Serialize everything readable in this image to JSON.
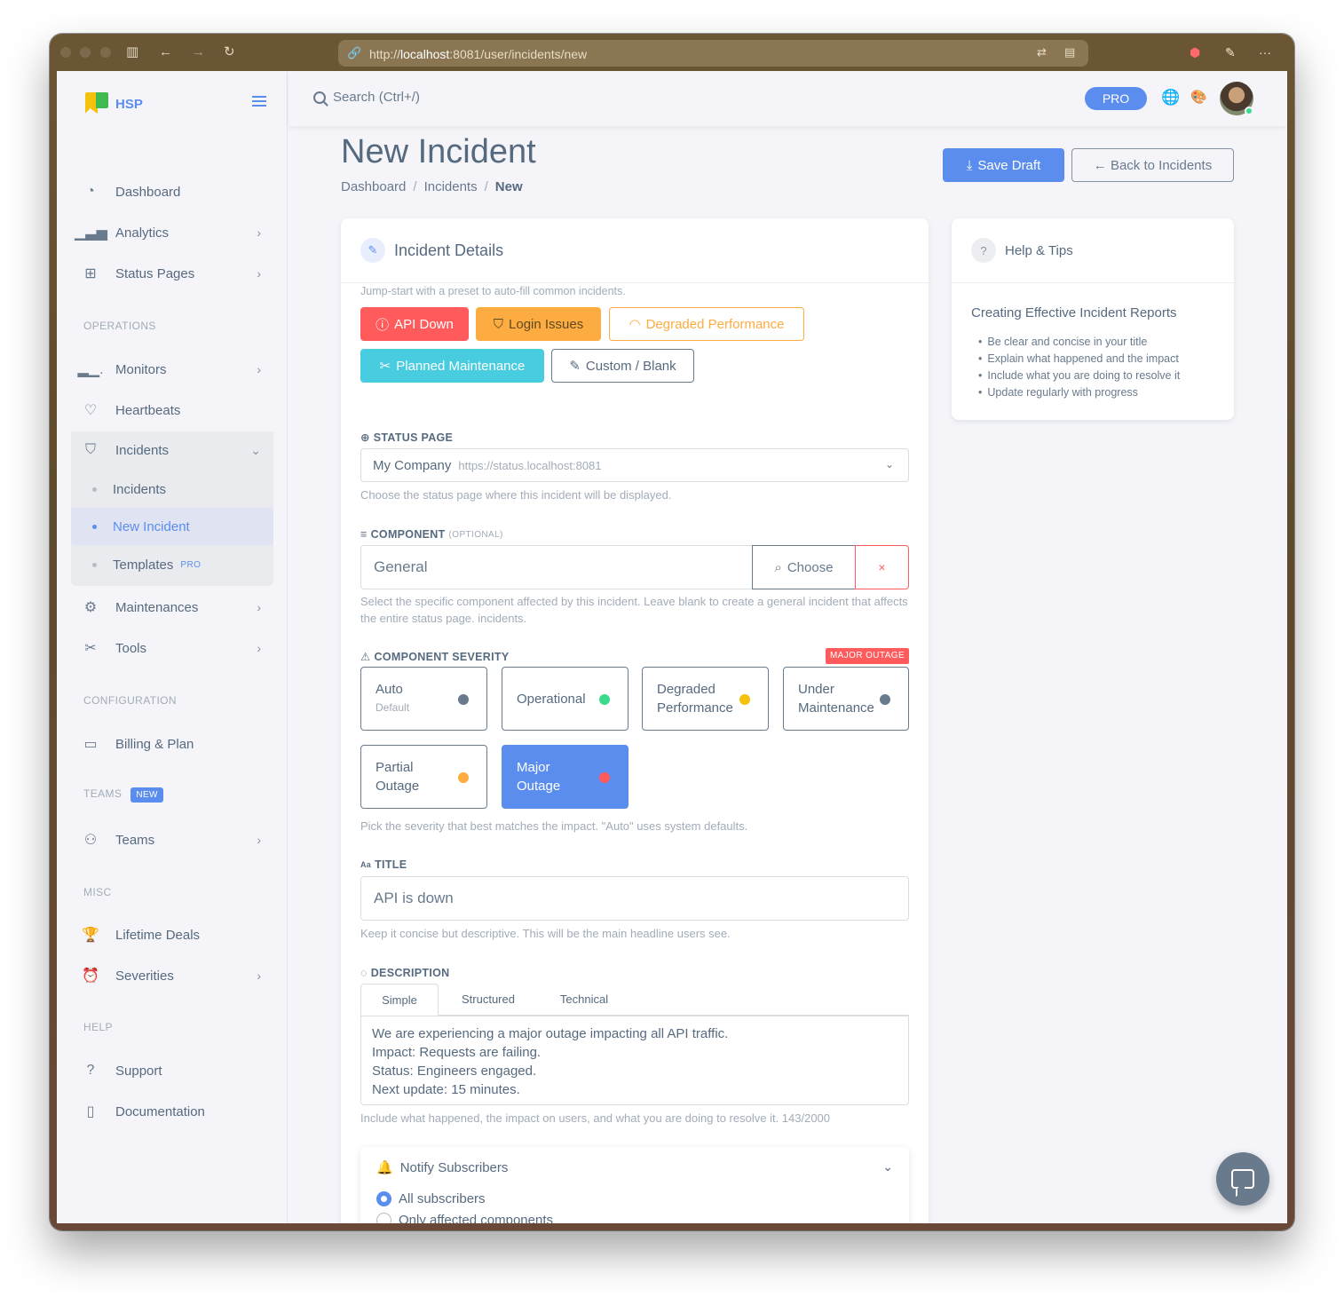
{
  "browser": {
    "url_prefix": "http://",
    "url_host": "localhost",
    "url_rest": ":8081/user/incidents/new"
  },
  "sidebar": {
    "brand": "HSP",
    "items": [
      {
        "label": "Dashboard",
        "icon": "gauge-icon"
      },
      {
        "label": "Analytics",
        "icon": "bar-chart-icon"
      },
      {
        "label": "Status Pages",
        "icon": "status-icon"
      }
    ],
    "section_operations": "OPERATIONS",
    "operations": [
      {
        "label": "Monitors",
        "icon": "monitor-icon"
      },
      {
        "label": "Heartbeats",
        "icon": "heart-pulse-icon"
      },
      {
        "label": "Incidents",
        "icon": "shield-icon"
      }
    ],
    "incidents_sub": [
      "Incidents",
      "New Incident",
      "Templates"
    ],
    "templates_badge": "PRO",
    "operations_more": [
      {
        "label": "Maintenances",
        "icon": "maintenance-icon"
      },
      {
        "label": "Tools",
        "icon": "tools-icon"
      }
    ],
    "section_config": "CONFIGURATION",
    "billing": "Billing & Plan",
    "section_teams": "TEAMS",
    "teams_badge": "NEW",
    "teams": "Teams",
    "section_misc": "MISC",
    "lifetime": "Lifetime Deals",
    "severities": "Severities",
    "section_help": "HELP",
    "support": "Support",
    "documentation": "Documentation"
  },
  "topbar": {
    "search_placeholder": "Search (Ctrl+/)",
    "pro": "PRO"
  },
  "page": {
    "title": "New Incident",
    "breadcrumb": [
      "Dashboard",
      "Incidents",
      "New"
    ],
    "save_draft": "Save Draft",
    "back": "← Back to Incidents"
  },
  "details": {
    "title": "Incident Details",
    "preset_hint": "Jump-start with a preset to auto-fill common incidents.",
    "presets": [
      "API Down",
      "Login Issues",
      "Degraded Performance",
      "Planned Maintenance",
      "Custom / Blank"
    ],
    "status_page_label": "STATUS PAGE",
    "status_page_value": "My Company",
    "status_page_url": "https://status.localhost:8081",
    "status_page_help": "Choose the status page where this incident will be displayed.",
    "component_label": "COMPONENT",
    "component_optional": "(OPTIONAL)",
    "component_value": "General",
    "choose": "Choose",
    "clear": "×",
    "component_help": "Select the specific component affected by this incident. Leave blank to create a general incident that affects the entire status page. incidents.",
    "severity_label": "COMPONENT SEVERITY",
    "severity_tag": "MAJOR OUTAGE",
    "severities": [
      {
        "line1": "Auto",
        "sub": "Default",
        "color": "#697a8d"
      },
      {
        "line1": "Operational",
        "line2": "",
        "color": "#39da8a"
      },
      {
        "line1": "Degraded",
        "line2": "Performance",
        "color": "#f4c20d"
      },
      {
        "line1": "Under",
        "line2": "Maintenance",
        "color": "#697a8d"
      },
      {
        "line1": "Partial",
        "line2": "Outage",
        "color": "#fdac41"
      },
      {
        "line1": "Major",
        "line2": "Outage",
        "color": "#ff5b5c"
      }
    ],
    "severity_help": "Pick the severity that best matches the impact. \"Auto\" uses system defaults.",
    "title_label": "TITLE",
    "title_value": "API is down",
    "title_help": "Keep it concise but descriptive. This will be the main headline users see.",
    "description_label": "DESCRIPTION",
    "tabs": [
      "Simple",
      "Structured",
      "Technical"
    ],
    "description_lines": [
      "We are experiencing a major outage impacting all API traffic.",
      "Impact: Requests are failing.",
      "Status: Engineers engaged.",
      "Next update: 15 minutes."
    ],
    "description_help": "Include what happened, the impact on users, and what you are doing to resolve it. 143/2000",
    "notify_title": "Notify Subscribers",
    "notify_options": [
      "All subscribers",
      "Only affected components"
    ]
  },
  "help": {
    "title": "Help & Tips",
    "subtitle": "Creating Effective Incident Reports",
    "tips": [
      "Be clear and concise in your title",
      "Explain what happened and the impact",
      "Include what you are doing to resolve it",
      "Update regularly with progress"
    ]
  }
}
